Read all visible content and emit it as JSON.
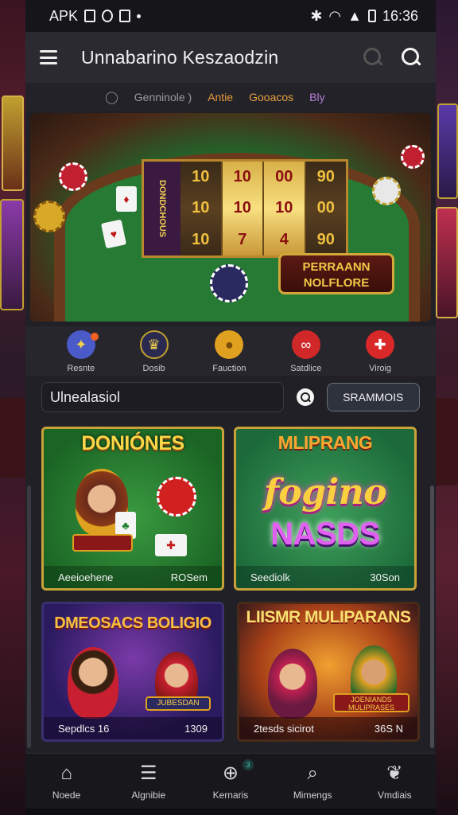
{
  "status_bar": {
    "left_text": "APK",
    "time": "16:36"
  },
  "app_bar": {
    "title": "Unnabarino Keszaodzin"
  },
  "filters": [
    "Genninole )",
    "Antie",
    "Gooacos",
    "Bly"
  ],
  "hero": {
    "plaque": "PERRAANN NOLFLORE",
    "reel_side": "DONDCHOUS",
    "reels": [
      [
        "10",
        "10",
        "10"
      ],
      [
        "10",
        "10",
        "7"
      ],
      [
        "00",
        "10",
        "4"
      ],
      [
        "90",
        "00",
        "90"
      ]
    ]
  },
  "categories": [
    {
      "label": "Resnte",
      "color": "#4a5ac8"
    },
    {
      "label": "Dosib",
      "color": "#2a2a50"
    },
    {
      "label": "Fauction",
      "color": "#e0a020"
    },
    {
      "label": "Satdlice",
      "color": "#d02828"
    },
    {
      "label": "Viroig",
      "color": "#d82828"
    }
  ],
  "search": {
    "value": "Ulnealasiol",
    "button_label": "SRAMMOIS"
  },
  "tiles": [
    {
      "title": "DONIÓNES",
      "caption_left": "Aeeioehene",
      "caption_right": "ROSem"
    },
    {
      "title_a": "MLIPRANG",
      "title_b": "fogino",
      "title_c": "NASDS",
      "caption_left": "Seediolk",
      "caption_right": "30Son"
    },
    {
      "title": "DMEOSACS BOLIGIO",
      "badge": "JUBESDAN",
      "caption_left": "Sepdlcs 16",
      "caption_right": "1309"
    },
    {
      "title": "LIISMR MULIPARANS",
      "badge": "JOENIANDS MULIPRASES",
      "caption_left": "2tesds sicirot",
      "caption_right": "36S N"
    }
  ],
  "bottom_nav": [
    {
      "label": "Noede",
      "icon": "home-icon"
    },
    {
      "label": "Algnibie",
      "icon": "list-icon"
    },
    {
      "label": "Kernaris",
      "icon": "compass-icon",
      "badge": "3"
    },
    {
      "label": "Mimengs",
      "icon": "search-icon"
    },
    {
      "label": "Vmdiais",
      "icon": "leaf-icon"
    }
  ]
}
